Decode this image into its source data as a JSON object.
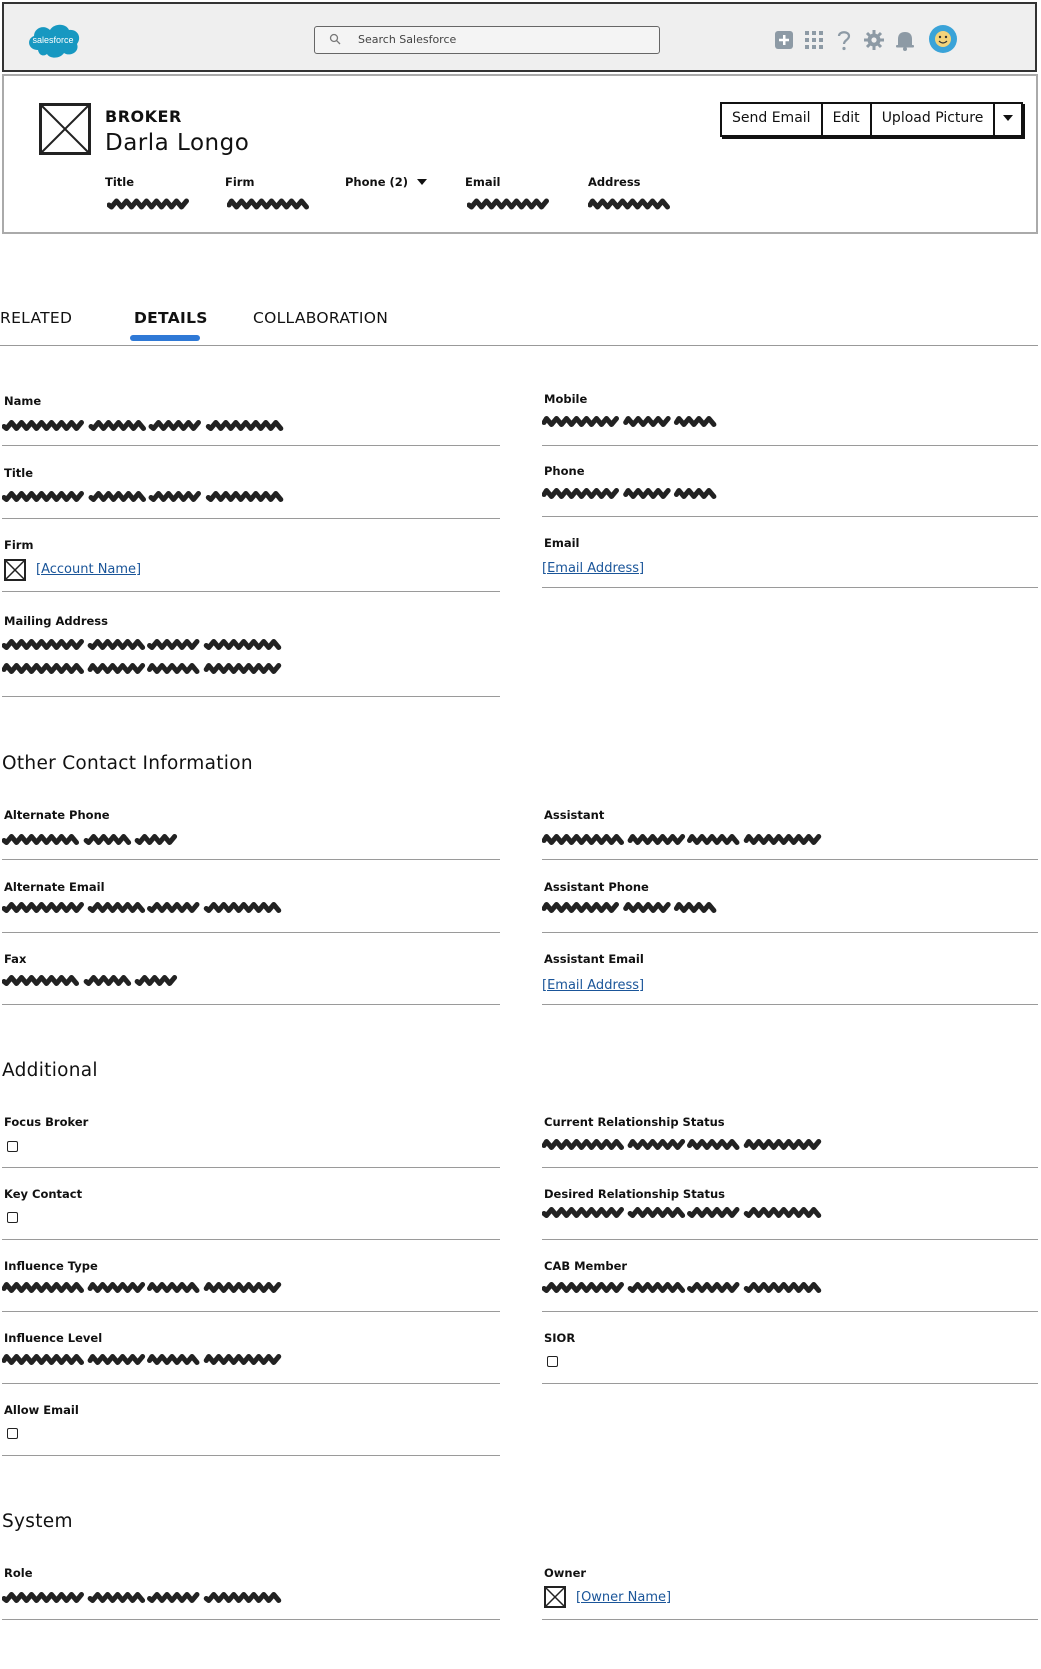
{
  "topbar": {
    "logo_text": "salesforce",
    "search_placeholder": "Search Salesforce",
    "icons": [
      "add-icon",
      "app-launcher-icon",
      "help-icon",
      "setup-gear-icon",
      "notifications-bell-icon",
      "user-avatar-icon"
    ],
    "colors": {
      "bar_bg": "#efefef",
      "logo": "#1798c1",
      "avatar": "#3aa3d8"
    }
  },
  "header": {
    "object_type": "BROKER",
    "record_name": "Darla Longo",
    "fields": {
      "title": "Title",
      "firm": "Firm",
      "phone": "Phone (2)",
      "email": "Email",
      "address": "Address"
    },
    "buttons": {
      "send_email": "Send Email",
      "edit": "Edit",
      "upload_picture": "Upload Picture"
    }
  },
  "tabs": {
    "related": "RELATED",
    "details": "DETAILS",
    "collaboration": "COLLABORATION",
    "active": "DETAILS",
    "accent": "#2f79d6"
  },
  "details": {
    "name": "Name",
    "mobile": "Mobile",
    "title": "Title",
    "phone": "Phone",
    "firm": "Firm",
    "firm_link": "[Account Name]",
    "email": "Email",
    "email_link": "[Email Address]",
    "mailing_address": "Mailing Address"
  },
  "other_contact": {
    "heading": "Other Contact Information",
    "alternate_phone": "Alternate Phone",
    "assistant": "Assistant",
    "alternate_email": "Alternate Email",
    "assistant_phone": "Assistant Phone",
    "fax": "Fax",
    "assistant_email": "Assistant Email",
    "assistant_email_link": "[Email Address]"
  },
  "additional": {
    "heading": "Additional",
    "focus_broker": "Focus Broker",
    "current_relationship_status": "Current Relationship Status",
    "key_contact": "Key Contact",
    "desired_relationship_status": "Desired Relationship Status",
    "influence_type": "Influence Type",
    "cab_member": "CAB Member",
    "influence_level": "Influence Level",
    "sior": "SIOR",
    "allow_email": "Allow Email"
  },
  "system": {
    "heading": "System",
    "role": "Role",
    "owner": "Owner",
    "owner_link": "[Owner Name]"
  },
  "colors": {
    "link": "#1a5599",
    "divider": "#9a9a9a"
  }
}
